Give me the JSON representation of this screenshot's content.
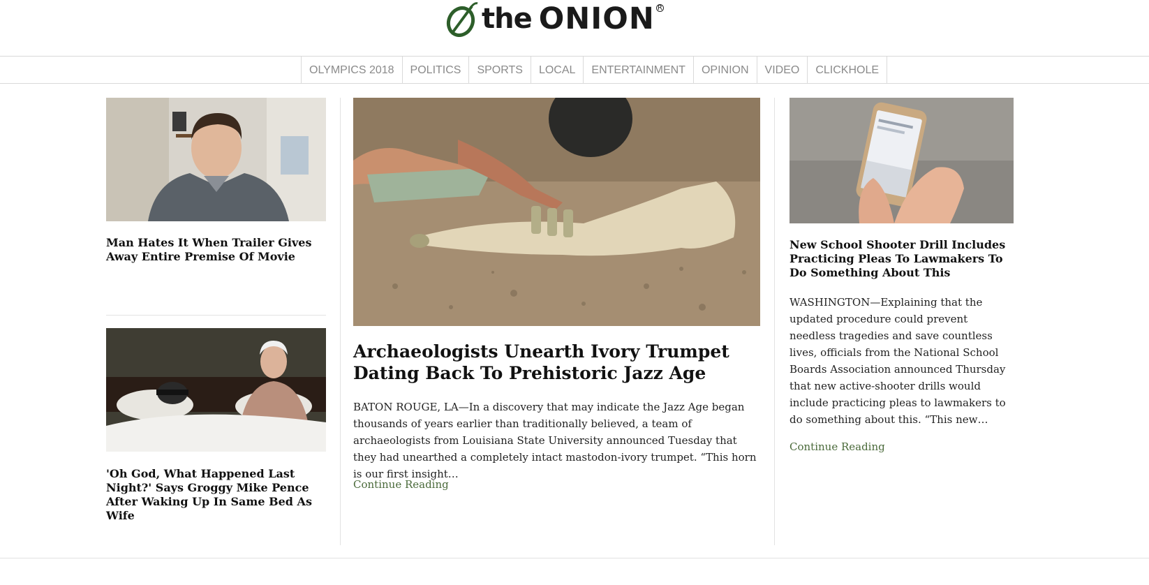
{
  "logo": {
    "word_the": "the",
    "word_onion": "ONION",
    "reg": "R"
  },
  "nav": {
    "items": [
      "OLYMPICS 2018",
      "POLITICS",
      "SPORTS",
      "LOCAL",
      "ENTERTAINMENT",
      "OPINION",
      "VIDEO",
      "CLICKHOLE"
    ]
  },
  "left": {
    "story1": {
      "headline": "Man Hates It When Trailer Gives Away Entire Premise Of Movie"
    },
    "story2": {
      "headline": "'Oh God, What Happened Last Night?' Says Groggy Mike Pence After Waking Up In Same Bed As Wife"
    }
  },
  "center": {
    "headline": "Archaeologists Unearth Ivory Trumpet Dating Back To Prehistoric Jazz Age",
    "excerpt": "BATON ROUGE, LA—In a discovery that may indicate the Jazz Age began thousands of years earlier than traditionally believed, a team of archaeologists from Louisiana State University announced Tuesday that they had unearthed a completely intact mastodon-ivory trumpet. “This horn is our first insight…",
    "continue": "Continue Reading"
  },
  "right": {
    "headline": "New School Shooter Drill Includes Practicing Pleas To Lawmakers To Do Something About This",
    "excerpt": "WASHINGTON—Explaining that the updated procedure could prevent needless tragedies and save countless lives, officials from the National School Boards Association announced Thursday that new active-shooter drills would include practicing pleas to lawmakers to do something about this. “This new…",
    "continue": "Continue Reading"
  },
  "colors": {
    "logo_green": "#2d5e2a",
    "nav_text": "#8a8a8a",
    "link_green": "#4a6a3a",
    "rule": "#e2e2e2"
  }
}
